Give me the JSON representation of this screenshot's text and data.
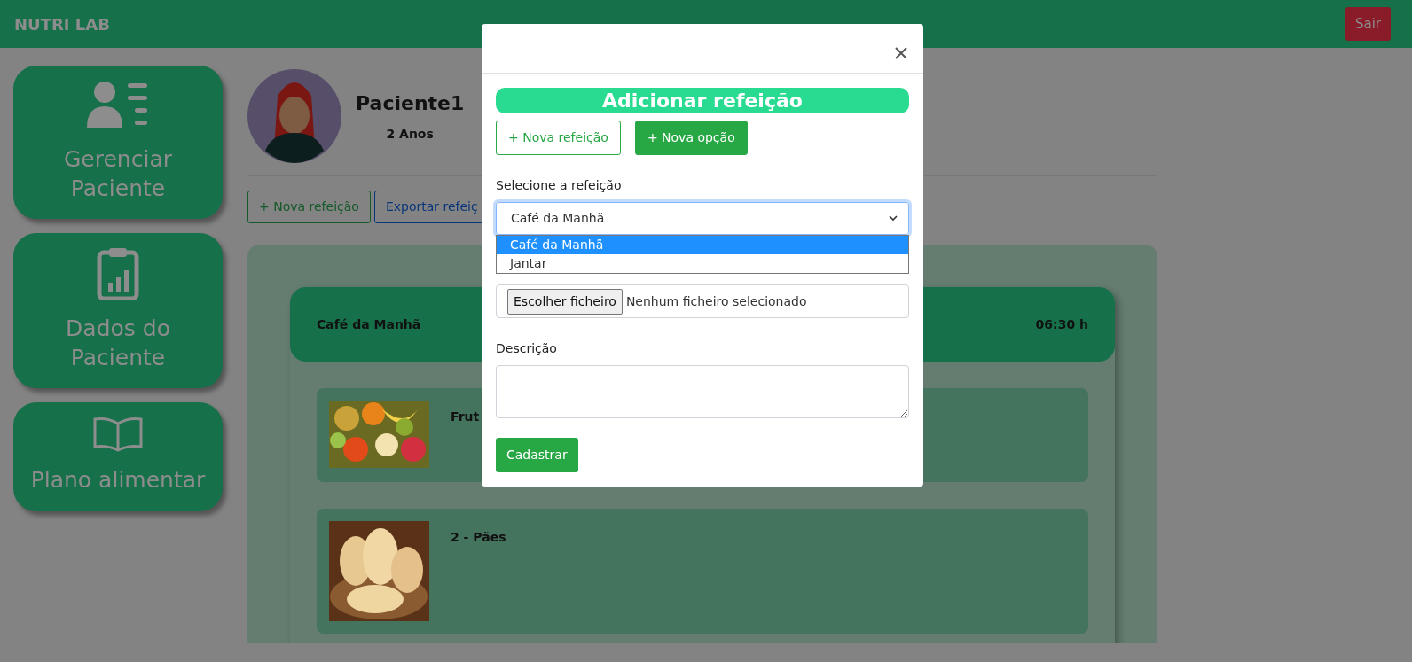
{
  "navbar": {
    "brand": "NUTRI LAB",
    "logout_button": "Sair"
  },
  "sidebar": {
    "items": [
      {
        "label": "Gerenciar Paciente"
      },
      {
        "label": "Dados do Paciente"
      },
      {
        "label": "Plano alimentar"
      }
    ]
  },
  "patient": {
    "name": "Paciente1",
    "age": "2 Anos"
  },
  "actions": [
    {
      "label": "+ Nova refeição",
      "kind": "success"
    },
    {
      "label": "Exportar refeiç",
      "kind": "primary"
    }
  ],
  "meal": {
    "title": "Café da Manhã",
    "time": "06:30 h",
    "options": [
      {
        "label": "Frut",
        "kind": "fruits"
      },
      {
        "label": "2 - Pães",
        "kind": "bread"
      }
    ]
  },
  "modal": {
    "title": "Adicionar refeição",
    "buttons": [
      {
        "label": "+ Nova refeição",
        "kind": "outline"
      },
      {
        "label": "+ Nova opção",
        "kind": "solid"
      }
    ],
    "select": {
      "label": "Selecione a refeição",
      "value": "Café da Manhã",
      "expanded": true,
      "options": [
        {
          "label": "Café da Manhã",
          "selected": true
        },
        {
          "label": "Jantar",
          "selected": false
        }
      ]
    },
    "file": {
      "button": "Escolher ficheiro",
      "status": "Nenhum ficheiro selecionado"
    },
    "description": {
      "label": "Descrição"
    },
    "submit": "Cadastrar"
  }
}
